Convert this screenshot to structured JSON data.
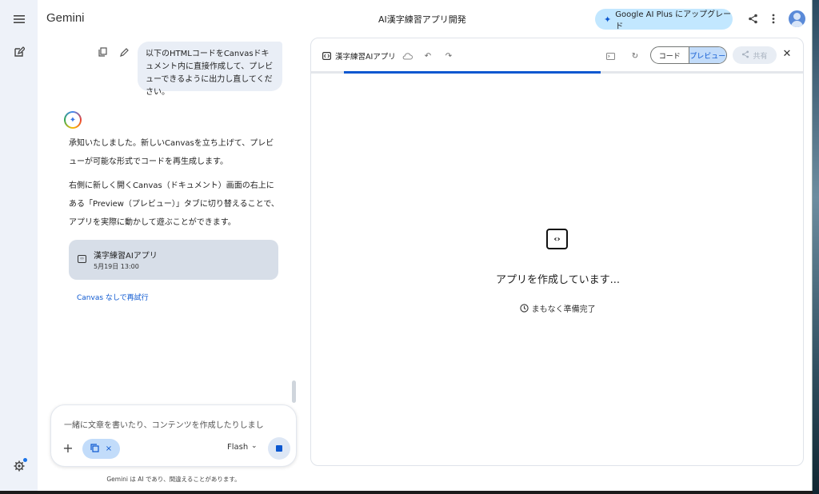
{
  "app": {
    "brand": "Gemini",
    "title": "AI漢字練習アプリ開発"
  },
  "rail": {
    "icons": [
      "menu-icon",
      "new-chat-icon",
      "settings-icon"
    ]
  },
  "header": {
    "upgrade_label": "Google AI Plus にアップグレード",
    "icons": [
      "share-icon",
      "more-vert-icon",
      "account-avatar"
    ]
  },
  "chat": {
    "user_message": "以下のHTMLコードをCanvasドキュメント内に直接作成して、プレビューできるように出力し直してください。",
    "response_p1": "承知いたしました。新しいCanvasを立ち上げて、プレビューが可能な形式でコードを再生成します。",
    "response_p2": "右側に新しく開くCanvas（ドキュメント）画面の右上にある「Preview（プレビュー）」タブに切り替えることで、アプリを実際に動かして遊ぶことができます。",
    "canvas_card": {
      "title": "漢字練習AIアプリ",
      "date": "5月19日 13:00"
    },
    "retry_label": "Canvas なしで再試行"
  },
  "input": {
    "text": "一緒に文章を書いたり、コンテンツを作成したりしまし",
    "model": "Flash",
    "chip_close": "×"
  },
  "disclaimer": "Gemini は AI であり、間違えることがあります。",
  "canvas": {
    "title": "漢字練習AIアプリ",
    "tabs": {
      "code": "コード",
      "preview": "プレビュー"
    },
    "active_tab": "preview",
    "share_label": "共有",
    "progress": 0.6,
    "status": "アプリを作成しています...",
    "substatus": "まもなく準備完了"
  },
  "colors": {
    "accent": "#0b57d0",
    "upgrade_bg": "#c2e7ff",
    "rail_bg": "#eef2f9"
  }
}
